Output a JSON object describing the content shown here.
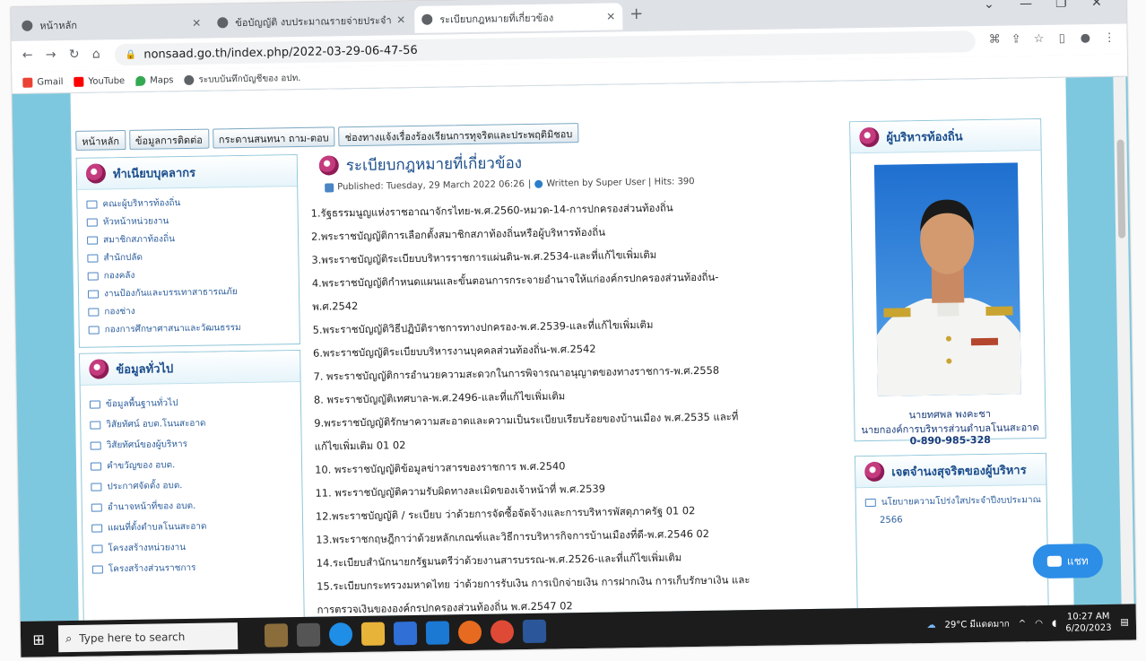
{
  "browser": {
    "tabs": [
      {
        "title": "หน้าหลัก"
      },
      {
        "title": "ข้อบัญญัติ งบประมาณรายจ่ายประจำปี"
      },
      {
        "title": "ระเบียบกฎหมายที่เกี่ยวข้อง"
      }
    ],
    "url": "nonsaad.go.th/index.php/2022-03-29-06-47-56",
    "bookmarks": [
      "Gmail",
      "YouTube",
      "Maps",
      "ระบบบันทึกบัญชีของ อปท."
    ]
  },
  "menu": [
    "หน้าหลัก",
    "ข้อมูลการติดต่อ",
    "กระดานสนทนา ถาม-ตอบ",
    "ช่องทางแจ้งเรื่องร้องเรียนการทุจริตและประพฤติมิชอบ"
  ],
  "left_boxes": [
    {
      "heading": "ทำเนียบบุคลากร",
      "items": [
        "คณะผู้บริหารท้องถิ่น",
        "หัวหน้าหน่วยงาน",
        "สมาชิกสภาท้องถิ่น",
        "สำนักปลัด",
        "กองคลัง",
        "งานป้องกันและบรรเทาสาธารณภัย",
        "กองช่าง",
        "กองการศึกษาศาสนาและวัฒนธรรม"
      ]
    },
    {
      "heading": "ข้อมูลทั่วไป",
      "items": [
        "ข้อมูลพื้นฐานทั่วไป",
        "วิสัยทัศน์ อบต.โนนสะอาด",
        "วิสัยทัศน์ของผู้บริหาร",
        "คำขวัญของ อบต.",
        "ประกาศจัดตั้ง อบต.",
        "อำนาจหน้าที่ของ อบต.",
        "แผนที่ตั้งตำบลโนนสะอาด",
        "โครงสร้างหน่วยงาน",
        "โครงสร้างส่วนราชการ"
      ]
    }
  ],
  "article": {
    "title": "ระเบียบกฎหมายที่เกี่ยวข้อง",
    "meta_published": "Published: Tuesday, 29 March 2022 06:26",
    "meta_author": "Written by Super User | Hits: 390",
    "lines": [
      "1.รัฐธรรมนูญแห่งราชอาณาจักรไทย-พ.ศ.2560-หมวด-14-การปกครองส่วนท้องถิ่น",
      "2.พระราชบัญญัติการเลือกตั้งสมาชิกสภาท้องถิ่นหรือผู้บริหารท้องถิ่น",
      "3.พระราชบัญญัติระเบียบบริหารราชการแผ่นดิน-พ.ศ.2534-และที่แก้ไขเพิ่มเติม",
      "4.พระราชบัญญัติกำหนดแผนและขั้นตอนการกระจายอำนาจให้แก่องค์กรปกครองส่วนท้องถิ่น-",
      "พ.ศ.2542",
      "5.พระราชบัญญัติวิธีปฏิบัติราชการทางปกครอง-พ.ศ.2539-และที่แก้ไขเพิ่มเติม",
      "6.พระราชบัญญัติระเบียบบริหารงานบุคคลส่วนท้องถิ่น-พ.ศ.2542",
      "7. พระราชบัญญัติการอำนวยความสะดวกในการพิจารณาอนุญาตของทางราชการ-พ.ศ.2558",
      "8. พระราชบัญญัติเทศบาล-พ.ศ.2496-และที่แก้ไขเพิ่มเติม",
      "9.พระราชบัญญัติรักษาความสะอาดและความเป็นระเบียบเรียบร้อยของบ้านเมือง พ.ศ.2535 และที่",
      "แก้ไขเพิ่มเติม 01 02",
      "10. พระราชบัญญัติข้อมูลข่าวสารของราชการ พ.ศ.2540",
      "11. พระราชบัญญัติความรับผิดทางละเมิดของเจ้าหน้าที่ พ.ศ.2539",
      "12.พระราชบัญญัติ / ระเบียบ ว่าด้วยการจัดซื้อจัดจ้างและการบริหารพัสดุภาครัฐ 01 02",
      "13.พระราชกฤษฎีกาว่าด้วยหลักเกณฑ์และวิธีการบริหารกิจการบ้านเมืองที่ดี-พ.ศ.2546 02",
      "14.ระเบียบสำนักนายกรัฐมนตรีว่าด้วยงานสารบรรณ-พ.ศ.2526-และที่แก้ไขเพิ่มเติม",
      "15.ระเบียบกระทรวงมหาดไทย ว่าด้วยการรับเงิน การเบิกจ่ายเงิน การฝากเงิน การเก็บรักษาเงิน และ",
      "การตรวจเงินขององค์กรปกครองส่วนท้องถิ่น พ.ศ.2547 02"
    ]
  },
  "right": {
    "exec_heading": "ผู้บริหารท้องถิ่น",
    "exec_name": "นายทศพล พงคะชา",
    "exec_title": "นายกองค์การบริหารส่วนตำบลโนนสะอาด",
    "exec_phone": "0-890-985-328",
    "intent_heading": "เจตจำนงสุจริตของผู้บริหาร",
    "intent_item": "นโยบายความโปร่งใสประจำปีงบประมาณ",
    "intent_year": "2566"
  },
  "chat_label": "แชท",
  "taskbar": {
    "search_placeholder": "Type here to search",
    "weather": "29°C มีแดดมาก",
    "time": "10:27 AM",
    "date": "6/20/2023"
  },
  "colors": {
    "page_bg": "#7ec8df",
    "heading": "#1b4d8c",
    "link": "#2b5d9b"
  }
}
